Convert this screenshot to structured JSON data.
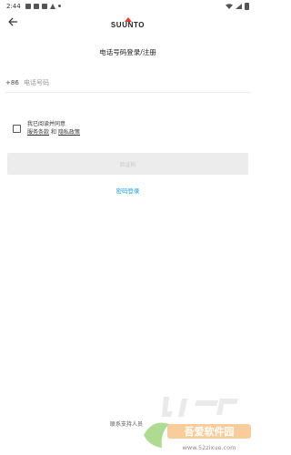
{
  "status_bar": {
    "time": "2:44"
  },
  "header": {
    "logo_text": "SUUNTO"
  },
  "page_title": "电话号码登录/注册",
  "phone": {
    "country_code": "+86",
    "placeholder": "电话号码"
  },
  "agreement": {
    "line1": "我已阅读并同意",
    "terms_link": "服务条款",
    "and": "和",
    "privacy_link": "隐私政策"
  },
  "verify_button_label": "验证码",
  "password_login_label": "密码登录",
  "contact_support_label": "联系支持人员",
  "watermark": {
    "text": "吾爱软件园",
    "url": "www.52zixue.com"
  },
  "colors": {
    "link_blue": "#1aa0d6",
    "logo_red": "#e53a2f",
    "button_bg": "#ececec"
  }
}
